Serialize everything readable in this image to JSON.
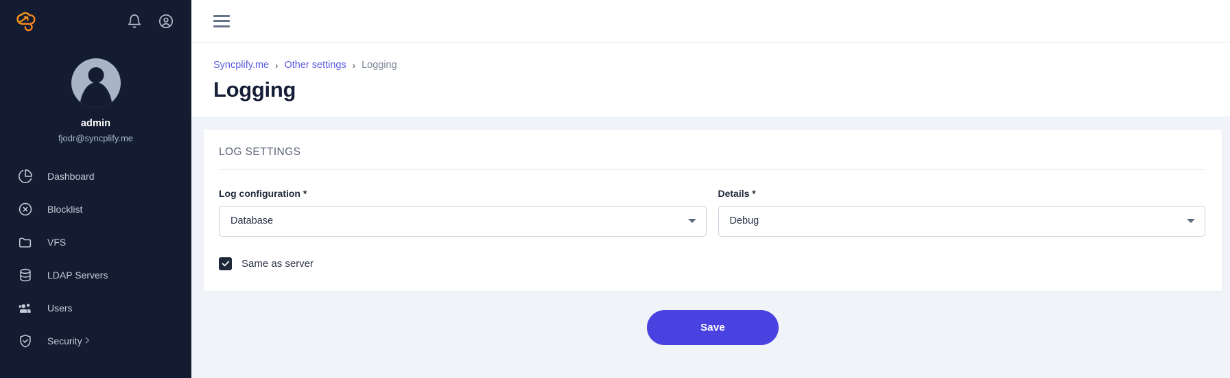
{
  "brand": {
    "logo_icon": "syncplify-cloud-logo",
    "accent_color": "#f7941d",
    "sidebar_bg": "#131c30",
    "primary_color": "#4a42e0"
  },
  "sidebar": {
    "notifications_icon": "bell-icon",
    "account_icon": "user-circle-icon",
    "avatar_icon": "avatar",
    "user_name": "admin",
    "user_email": "fjodr@syncplify.me",
    "items": [
      {
        "label": "Dashboard",
        "icon": "pie-chart-icon",
        "has_chevron": false
      },
      {
        "label": "Blocklist",
        "icon": "block-circle-icon",
        "has_chevron": false
      },
      {
        "label": "VFS",
        "icon": "folder-icon",
        "has_chevron": false
      },
      {
        "label": "LDAP Servers",
        "icon": "database-icon",
        "has_chevron": false
      },
      {
        "label": "Users",
        "icon": "users-icon",
        "has_chevron": false
      },
      {
        "label": "Security",
        "icon": "shield-check-icon",
        "has_chevron": true
      }
    ]
  },
  "topbar": {
    "menu_icon": "hamburger-menu-icon"
  },
  "breadcrumb": {
    "items": [
      {
        "label": "Syncplify.me",
        "is_link": true
      },
      {
        "label": "Other settings",
        "is_link": true
      },
      {
        "label": "Logging",
        "is_link": false
      }
    ],
    "separator": "›"
  },
  "page": {
    "title": "Logging"
  },
  "card": {
    "title": "LOG SETTINGS",
    "fields": [
      {
        "label": "Log configuration *",
        "value": "Database",
        "caret_icon": "chevron-down-icon"
      },
      {
        "label": "Details *",
        "value": "Debug",
        "caret_icon": "chevron-down-icon"
      }
    ],
    "checkbox": {
      "label": "Same as server",
      "checked": true,
      "check_icon": "check-icon"
    }
  },
  "actions": {
    "save_label": "Save"
  }
}
